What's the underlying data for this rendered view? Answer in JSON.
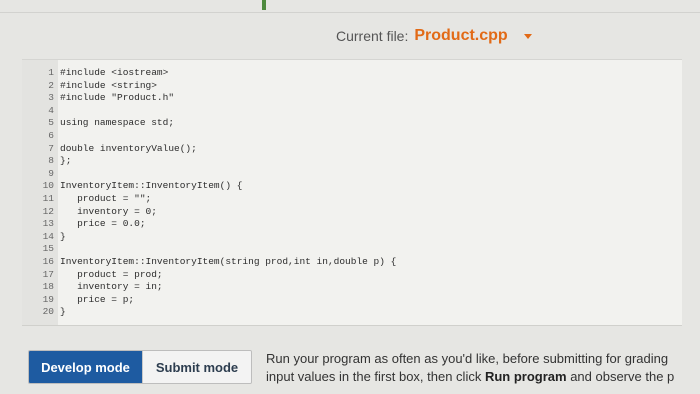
{
  "header": {
    "file_label": "Current file:",
    "file_name": "Product.cpp"
  },
  "code": [
    {
      "n": "1",
      "t": "#include <iostream>"
    },
    {
      "n": "2",
      "t": "#include <string>"
    },
    {
      "n": "3",
      "t": "#include \"Product.h\""
    },
    {
      "n": "4",
      "t": ""
    },
    {
      "n": "5",
      "t": "using namespace std;"
    },
    {
      "n": "6",
      "t": ""
    },
    {
      "n": "7",
      "t": "double inventoryValue();"
    },
    {
      "n": "8",
      "t": "};"
    },
    {
      "n": "9",
      "t": ""
    },
    {
      "n": "10",
      "t": "InventoryItem::InventoryItem() {"
    },
    {
      "n": "11",
      "t": "   product = \"\";"
    },
    {
      "n": "12",
      "t": "   inventory = 0;"
    },
    {
      "n": "13",
      "t": "   price = 0.0;"
    },
    {
      "n": "14",
      "t": "}"
    },
    {
      "n": "15",
      "t": ""
    },
    {
      "n": "16",
      "t": "InventoryItem::InventoryItem(string prod,int in,double p) {"
    },
    {
      "n": "17",
      "t": "   product = prod;"
    },
    {
      "n": "18",
      "t": "   inventory = in;"
    },
    {
      "n": "19",
      "t": "   price = p;"
    },
    {
      "n": "20",
      "t": "}"
    }
  ],
  "modes": {
    "develop_label": "Develop mode",
    "submit_label": "Submit mode"
  },
  "instructions": {
    "line1": "Run your program as often as you'd like, before submitting for grading",
    "line2_pre": "input values in the first box, then click ",
    "line2_bold": "Run program",
    "line2_post": " and observe the p"
  }
}
